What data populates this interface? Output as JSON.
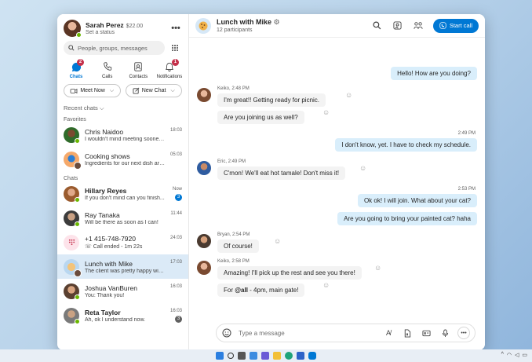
{
  "profile": {
    "name": "Sarah Perez",
    "credit": "$22.00",
    "status": "Set a status"
  },
  "search": {
    "placeholder": "People, groups, messages"
  },
  "nav": [
    {
      "label": "Chats",
      "badge": "2"
    },
    {
      "label": "Calls"
    },
    {
      "label": "Contacts"
    },
    {
      "label": "Notifications",
      "badge": "1"
    }
  ],
  "actions": {
    "meet_now": "Meet Now",
    "new_chat": "New Chat"
  },
  "recent_label": "Recent chats",
  "favorites_label": "Favorites",
  "chats_label": "Chats",
  "favorites": [
    {
      "name": "Chris Naidoo",
      "preview": "I wouldn't mind meeting sooner...",
      "time": "18:03"
    },
    {
      "name": "Cooking shows",
      "preview": "Ingredients for our next dish are...",
      "time": "05:03"
    }
  ],
  "chats": [
    {
      "name": "Hillary Reyes",
      "preview": "If you don't mind can you finish...",
      "time": "Now",
      "badge": "3"
    },
    {
      "name": "Ray Tanaka",
      "preview": "Will be there as soon as I can!",
      "time": "11:44"
    },
    {
      "name": "+1 415-748-7920",
      "preview": "Call ended - 1m 22s",
      "time": "24:03"
    },
    {
      "name": "Lunch with Mike",
      "preview": "The client was pretty happy with...",
      "time": "17:03"
    },
    {
      "name": "Joshua VanBuren",
      "preview": "You: Thank you!",
      "time": "16:03"
    },
    {
      "name": "Reta Taylor",
      "preview": "Ah, ok I understand now.",
      "time": "16:03",
      "badge": "3"
    }
  ],
  "conversation": {
    "title": "Lunch with Mike",
    "subtitle": "12 participants",
    "start_call": "Start call",
    "messages": {
      "m1": "Hello! How are you doing?",
      "keiko_meta_1": "Keiko, 2:48 PM",
      "m2": "I'm great!! Getting ready for picnic.",
      "m3": "Are you joining us as well?",
      "time_1": "2:49 PM",
      "m4": "I don't know, yet. I have to check my schedule.",
      "eric_meta": "Eric, 2:49 PM",
      "m5": "C'mon! We'll eat hot tamale! Don't miss it!",
      "time_2": "2:53 PM",
      "m6": "Ok ok! I will join. What about your cat?",
      "m7": "Are you going to bring your painted cat? haha",
      "bryan_meta": "Bryan, 2:54 PM",
      "m8": "Of course!",
      "keiko_meta_2": "Keiko, 2:58 PM",
      "m9": "Amazing! I'll pick up the rest and see you there!",
      "m10_prefix": "For ",
      "m10_mention": "@all",
      "m10_suffix": " - 4pm, main gate!"
    },
    "composer_placeholder": "Type a message"
  },
  "colors": {
    "accent": "#0078d4",
    "outgoing_bubble": "#d9eefb",
    "incoming_bubble": "#f3f3f3",
    "selected_chat": "#dbeaf7"
  }
}
